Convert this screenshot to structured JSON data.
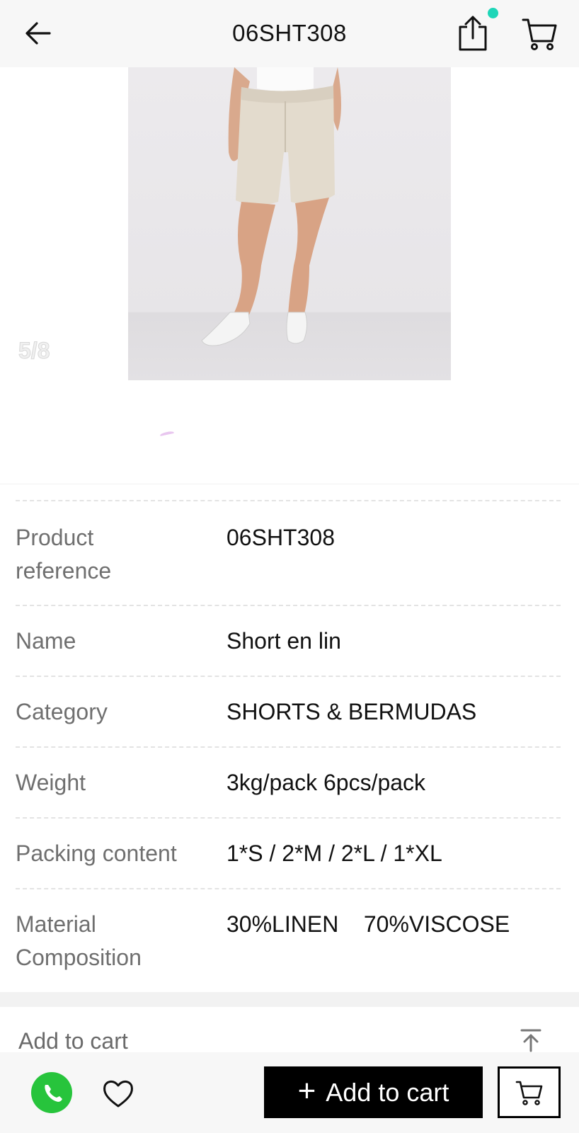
{
  "header": {
    "title": "06SHT308",
    "back_icon": "arrow-left-icon",
    "share_icon": "share-icon",
    "cart_icon": "cart-icon",
    "notification_dot_color": "#1ed6b8"
  },
  "gallery": {
    "counter": "5/8",
    "current_index": 5,
    "total": 8
  },
  "details": {
    "rows": [
      {
        "label": "Product\nreference",
        "value": "06SHT308"
      },
      {
        "label": "Name",
        "value": "Short en lin"
      },
      {
        "label": "Category",
        "value": "SHORTS & BERMUDAS"
      },
      {
        "label": "Weight",
        "value": "3kg/pack 6pcs/pack"
      },
      {
        "label": "Packing content",
        "value": "1*S / 2*M / 2*L / 1*XL"
      },
      {
        "label": "Material\nComposition",
        "value": "30%LINEN    70%VISCOSE"
      }
    ]
  },
  "add_to_cart_section": {
    "title": "Add to cart",
    "scroll_top_icon": "arrow-up-to-top-icon"
  },
  "bottom_bar": {
    "whatsapp_icon": "whatsapp-icon",
    "favorite_icon": "heart-icon",
    "add_to_cart_label": "Add to cart",
    "cart_icon": "cart-icon",
    "whatsapp_color": "#27c43c"
  }
}
